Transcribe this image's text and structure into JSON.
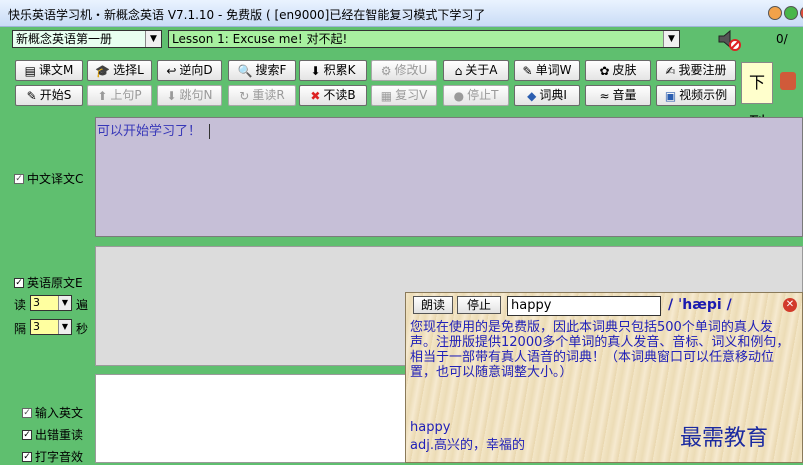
{
  "window": {
    "title": "快乐英语学习机・新概念英语 V7.1.10 - 免费版 ( [en9000]已经在智能复习模式下学习了",
    "counter": "0/"
  },
  "book_select": {
    "value": "新概念英语第一册"
  },
  "lesson_select": {
    "value": "Lesson 1: Excuse me! 对不起!"
  },
  "toolbar": {
    "row1": [
      {
        "label": "课文M",
        "icon": "document-icon",
        "glyph": "▤"
      },
      {
        "label": "选择L",
        "icon": "hat-icon",
        "glyph": "🎓"
      },
      {
        "label": "逆向D",
        "icon": "reverse-icon",
        "glyph": "↩"
      },
      {
        "label": "搜索F",
        "icon": "binoculars-icon",
        "glyph": "🔍"
      },
      {
        "label": "积累K",
        "icon": "accumulate-icon",
        "glyph": "⬇"
      },
      {
        "label": "修改U",
        "icon": "settings-icon",
        "glyph": "⚙"
      },
      {
        "label": "关于A",
        "icon": "home-icon",
        "glyph": "⌂"
      },
      {
        "label": "单词W",
        "icon": "words-icon",
        "glyph": "✎"
      },
      {
        "label": "皮肤",
        "icon": "skin-icon",
        "glyph": "✿"
      },
      {
        "label": "我要注册",
        "icon": "register-icon",
        "glyph": "✍"
      }
    ],
    "row2": [
      {
        "label": "开始S",
        "icon": "pencil-icon",
        "glyph": "✎"
      },
      {
        "label": "上句P",
        "icon": "arrow-up-icon",
        "glyph": "⬆"
      },
      {
        "label": "跳句N",
        "icon": "arrow-down-icon",
        "glyph": "⬇"
      },
      {
        "label": "重读R",
        "icon": "repeat-icon",
        "glyph": "↻"
      },
      {
        "label": "不读B",
        "icon": "stop-icon",
        "glyph": "✖"
      },
      {
        "label": "复习V",
        "icon": "review-icon",
        "glyph": "▦"
      },
      {
        "label": "停止T",
        "icon": "halt-icon",
        "glyph": "●"
      },
      {
        "label": "词典I",
        "icon": "dictionary-icon",
        "glyph": "◆"
      },
      {
        "label": "音量",
        "icon": "volume-icon",
        "glyph": "≈"
      },
      {
        "label": "视频示例",
        "icon": "video-icon",
        "glyph": "▣"
      }
    ],
    "next_label": "下列"
  },
  "left_panel": {
    "chinese_translation": "中文译文C",
    "english_original": "英语原文E",
    "read_label": "读",
    "read_value": "3",
    "read_unit": "遍",
    "interval_label": "隔",
    "interval_value": "3",
    "interval_unit": "秒",
    "input_english": "输入英文",
    "error_reread": "出错重读",
    "typing_sound": "打字音效"
  },
  "chinese_area": {
    "text": "可以开始学习了！"
  },
  "dictionary": {
    "read_btn": "朗读",
    "stop_btn": "停止",
    "word": "happy",
    "phonetic": "/ ˈhæpi /",
    "notice": "您现在使用的是免费版，因此本词典只包括500个单词的真人发声。注册版提供12000多个单词的真人发音、音标、词义和例句，相当于一部带有真人语音的词典！（本词典窗口可以任意移动位置，也可以随意调整大小。）",
    "entry_word": "happy",
    "definition": "adj.高兴的，幸福的"
  },
  "watermark": "最需教育",
  "colors": {
    "window_bg": "#5fbf6f",
    "chinese_bg": "#c6bfd7",
    "english_bg": "#dcdcdc",
    "text_blue": "#2020b8"
  }
}
